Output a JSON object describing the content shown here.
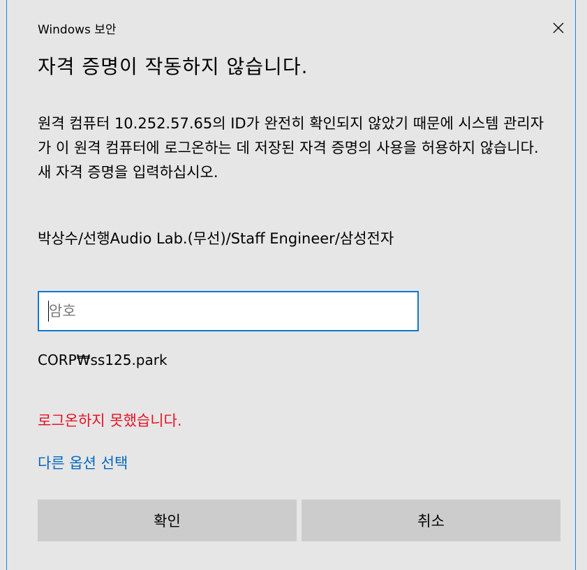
{
  "window": {
    "title": "Windows 보안",
    "close_icon": "close-icon"
  },
  "dialog": {
    "heading": "자격 증명이 작동하지 않습니다.",
    "message": "원격 컴퓨터 10.252.57.65의 ID가 완전히 확인되지 않았기 때문에 시스템 관리자가 이 원격 컴퓨터에 로그온하는 데 저장된 자격 증명의 사용을 허용하지 않습니다. 새 자격 증명을 입력하십시오.",
    "user_display_name": "박상수/선행Audio Lab.(무선)/Staff Engineer/삼성전자",
    "password": {
      "value": "",
      "placeholder": "암호"
    },
    "domain_user": "CORP₩ss125.park",
    "error_message": "로그온하지 못했습니다.",
    "more_choices_link": "다른 옵션 선택"
  },
  "buttons": {
    "ok_label": "확인",
    "cancel_label": "취소"
  },
  "colors": {
    "accent": "#0f77d0",
    "link": "#0067c0",
    "error": "#e81123",
    "background": "#e6e6e6",
    "button": "#cccccc"
  }
}
